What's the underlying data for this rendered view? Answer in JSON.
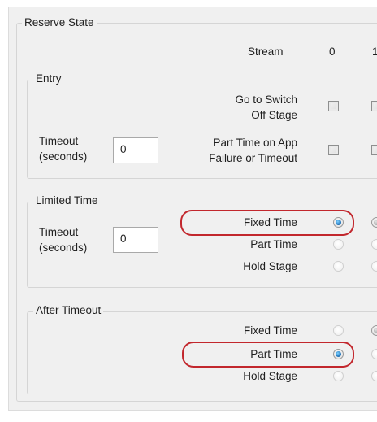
{
  "window": {
    "title": "Reserve State",
    "column_header_label": "Stream",
    "stream_columns": [
      "0",
      "1"
    ]
  },
  "entry": {
    "group_label": "Entry",
    "go_to_switch_line1": "Go to Switch",
    "go_to_switch_line2": "Off Stage",
    "part_time_failure_line1": "Part Time on App",
    "part_time_failure_line2": "Failure or Timeout",
    "timeout_label_line1": "Timeout",
    "timeout_label_line2": "(seconds)",
    "timeout_value": "0"
  },
  "limited_time": {
    "group_label": "Limited Time",
    "timeout_label_line1": "Timeout",
    "timeout_label_line2": "(seconds)",
    "timeout_value": "0",
    "options": [
      "Fixed Time",
      "Part Time",
      "Hold Stage"
    ],
    "selected_stream0": "Fixed Time"
  },
  "after_timeout": {
    "group_label": "After Timeout",
    "options": [
      "Fixed Time",
      "Part Time",
      "Hold Stage"
    ],
    "selected_stream0": "Part Time"
  },
  "colors": {
    "highlight": "#c2272d",
    "radio_selected": "#2a7fc4",
    "panel_bg": "#f0f0f0"
  }
}
